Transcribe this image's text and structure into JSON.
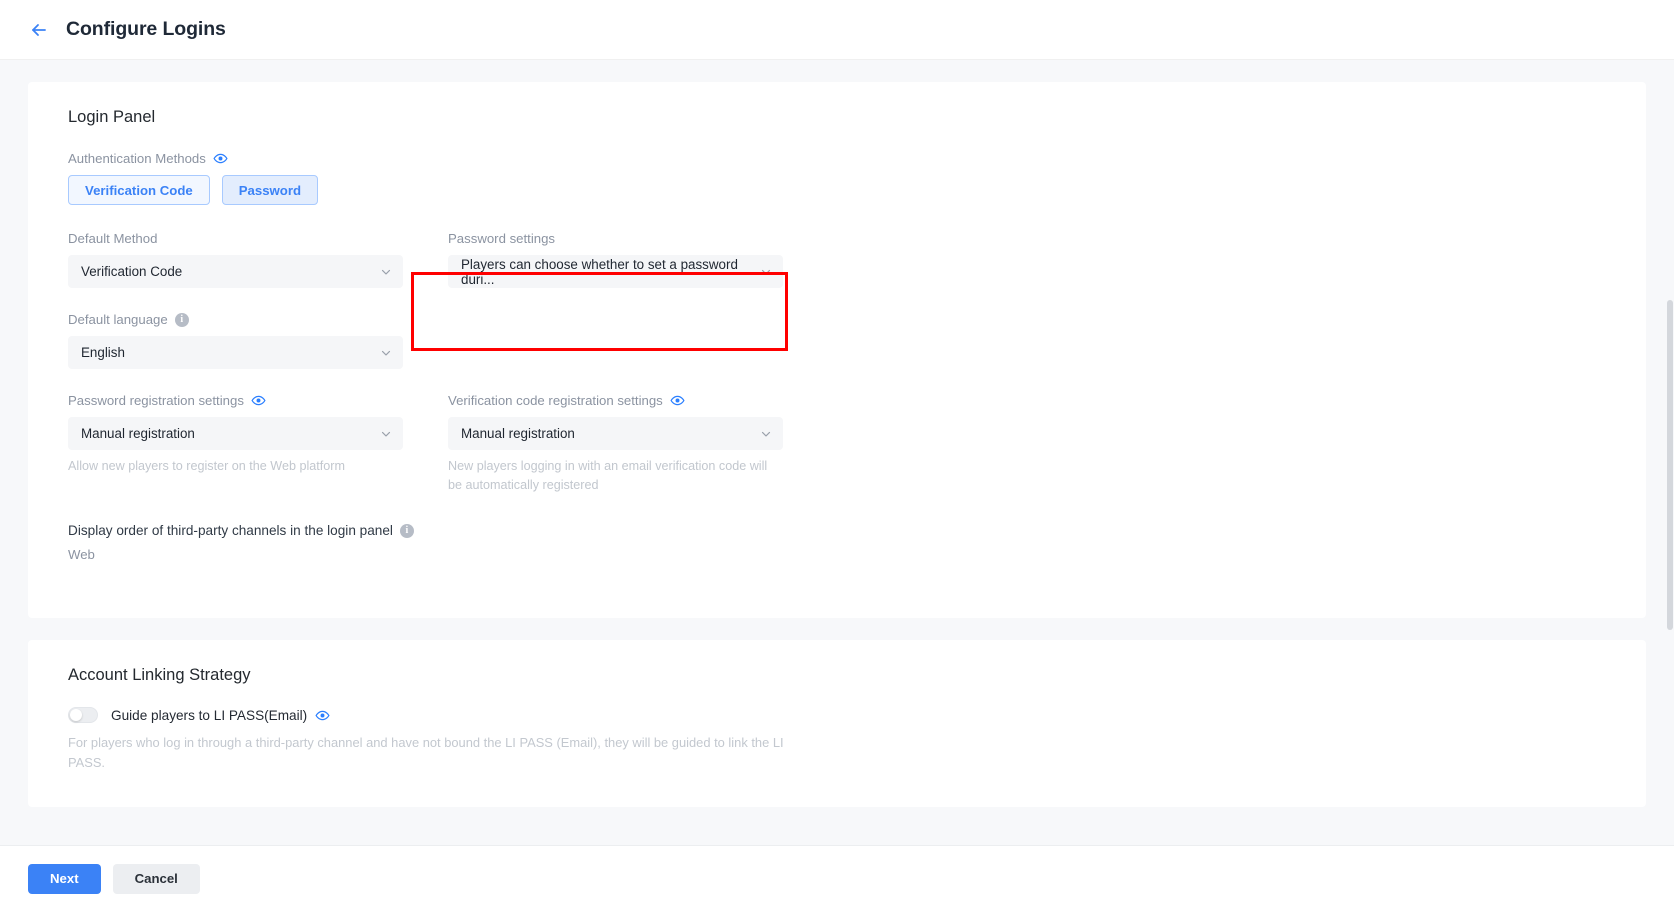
{
  "header": {
    "back_icon": "arrow-left-icon",
    "title": "Configure Logins"
  },
  "login_panel": {
    "title": "Login Panel",
    "auth_methods": {
      "label": "Authentication Methods",
      "eye_icon": "eye-icon",
      "chips": [
        {
          "label": "Verification Code"
        },
        {
          "label": "Password"
        }
      ]
    },
    "default_method": {
      "label": "Default Method",
      "value": "Verification Code"
    },
    "password_settings": {
      "label": "Password settings",
      "value": "Players can choose whether to set a password duri..."
    },
    "default_language": {
      "label": "Default language",
      "info_icon": "info-icon",
      "value": "English"
    },
    "password_registration": {
      "label": "Password registration settings",
      "eye_icon": "eye-icon",
      "value": "Manual registration",
      "helper": "Allow new players to register on the Web platform"
    },
    "verification_registration": {
      "label": "Verification code registration settings",
      "eye_icon": "eye-icon",
      "value": "Manual registration",
      "helper": "New players logging in with an email verification code will be automatically registered"
    },
    "display_order": {
      "label": "Display order of third-party channels in the login panel",
      "info_icon": "info-icon",
      "channels": [
        {
          "label": "Web"
        }
      ]
    }
  },
  "account_linking": {
    "title": "Account Linking Strategy",
    "toggle": {
      "label": "Guide players to LI PASS(Email)",
      "eye_icon": "eye-icon",
      "enabled": false
    },
    "description": "For players who log in through a third-party channel and have not bound the LI PASS (Email), they will be guided to link the LI PASS."
  },
  "footer": {
    "next_label": "Next",
    "cancel_label": "Cancel"
  },
  "colors": {
    "accent": "#3b82f6",
    "highlight": "#ff0000",
    "muted": "#8b93a1"
  }
}
